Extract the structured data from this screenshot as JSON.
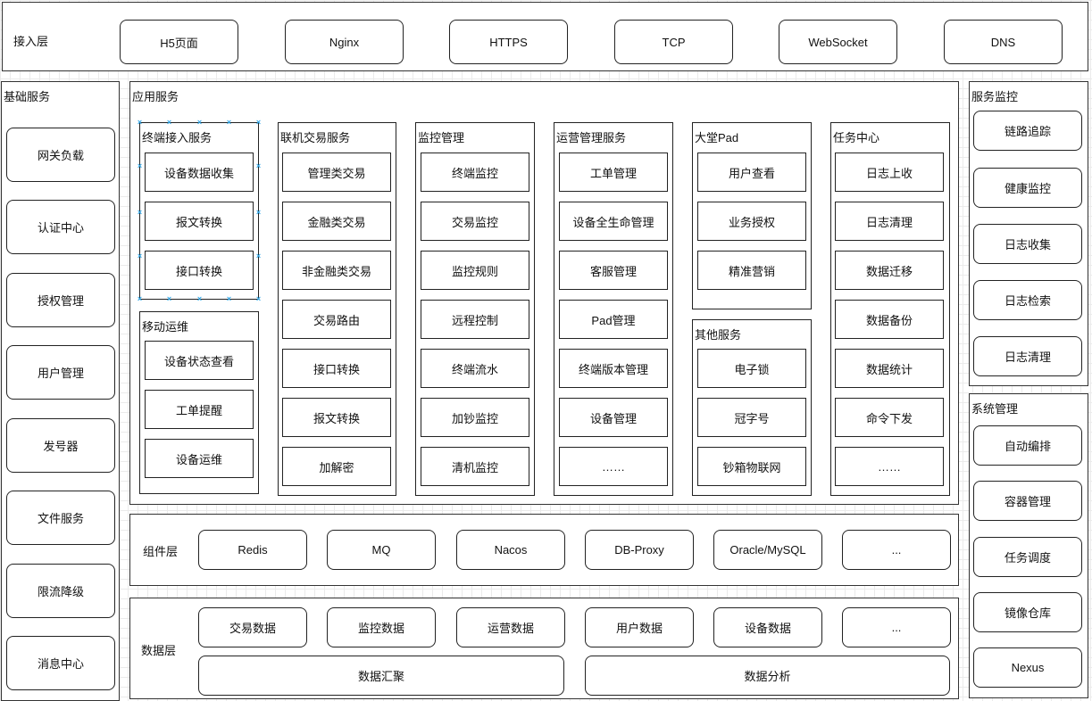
{
  "access_layer": {
    "label": "接入层",
    "items": [
      "H5页面",
      "Nginx",
      "HTTPS",
      "TCP",
      "WebSocket",
      "DNS"
    ]
  },
  "base_services": {
    "label": "基础服务",
    "items": [
      "网关负载",
      "认证中心",
      "授权管理",
      "用户管理",
      "发号器",
      "文件服务",
      "限流降级",
      "消息中心"
    ]
  },
  "app_services": {
    "label": "应用服务",
    "groups": [
      {
        "title": "终端接入服务",
        "items": [
          "设备数据收集",
          "报文转换",
          "接口转换"
        ],
        "selected": true
      },
      {
        "title": "移动运维",
        "items": [
          "设备状态查看",
          "工单提醒",
          "设备运维"
        ]
      },
      {
        "title": "联机交易服务",
        "items": [
          "管理类交易",
          "金融类交易",
          "非金融类交易",
          "交易路由",
          "接口转换",
          "报文转换",
          "加解密"
        ]
      },
      {
        "title": "监控管理",
        "items": [
          "终端监控",
          "交易监控",
          "监控规则",
          "远程控制",
          "终端流水",
          "加钞监控",
          "清机监控"
        ]
      },
      {
        "title": "运营管理服务",
        "items": [
          "工单管理",
          "设备全生命管理",
          "客服管理",
          "Pad管理",
          "终端版本管理",
          "设备管理",
          "……"
        ]
      },
      {
        "title": "大堂Pad",
        "items": [
          "用户查看",
          "业务授权",
          "精准营销"
        ]
      },
      {
        "title": "其他服务",
        "items": [
          "电子锁",
          "冠字号",
          "钞箱物联网"
        ]
      },
      {
        "title": "任务中心",
        "items": [
          "日志上收",
          "日志清理",
          "数据迁移",
          "数据备份",
          "数据统计",
          "命令下发",
          "……"
        ]
      }
    ]
  },
  "component_layer": {
    "label": "组件层",
    "items": [
      "Redis",
      "MQ",
      "Nacos",
      "DB-Proxy",
      "Oracle/MySQL",
      "..."
    ]
  },
  "data_layer": {
    "label": "数据层",
    "items": [
      "交易数据",
      "监控数据",
      "运营数据",
      "用户数据",
      "设备数据",
      "..."
    ],
    "wide_items": [
      "数据汇聚",
      "数据分析"
    ]
  },
  "service_monitor": {
    "label": "服务监控",
    "items": [
      "链路追踪",
      "健康监控",
      "日志收集",
      "日志检索",
      "日志清理"
    ]
  },
  "system_mgmt": {
    "label": "系统管理",
    "items": [
      "自动编排",
      "容器管理",
      "任务调度",
      "镜像仓库",
      "Nexus"
    ]
  },
  "colors": {
    "selection_handle": "#29a3e6",
    "border": "#222222",
    "grid": "#ebebeb"
  }
}
